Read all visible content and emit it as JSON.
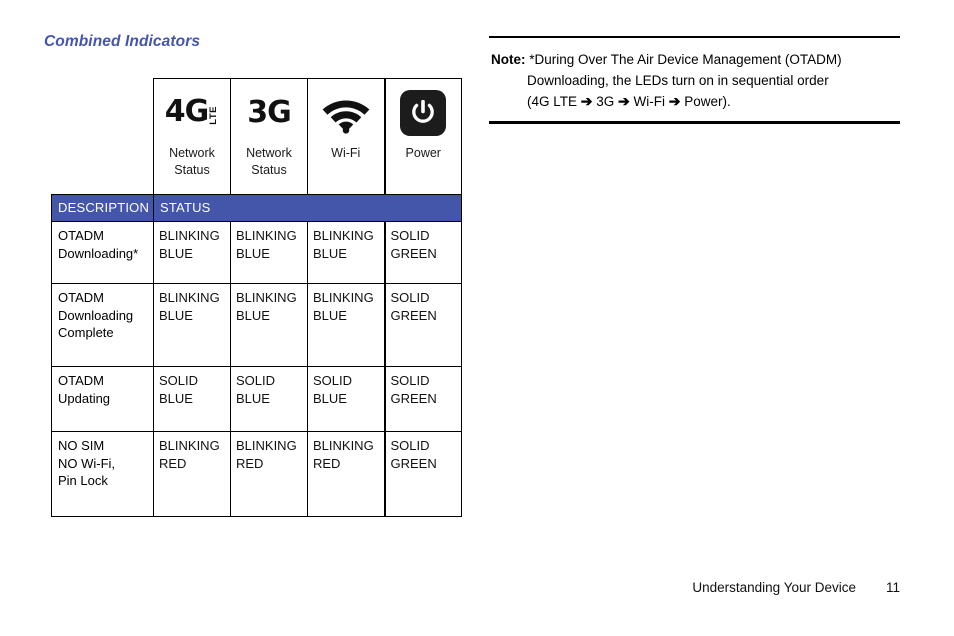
{
  "section": {
    "title": "Combined Indicators",
    "title_color": "#4455b0"
  },
  "table": {
    "accent_color": "#4456a9",
    "icon_header": [
      {
        "icon": "4g-lte-icon",
        "glyph_main": "4G",
        "glyph_sub": "LTE",
        "caption_line1": "Network",
        "caption_line2": "Status"
      },
      {
        "icon": "3g-icon",
        "glyph_main": "3G",
        "glyph_sub": "",
        "caption_line1": "Network",
        "caption_line2": "Status"
      },
      {
        "icon": "wifi-icon",
        "glyph_main": "",
        "glyph_sub": "",
        "caption_line1": "Wi-Fi",
        "caption_line2": ""
      },
      {
        "icon": "power-icon",
        "glyph_main": "",
        "glyph_sub": "",
        "caption_line1": "Power",
        "caption_line2": ""
      }
    ],
    "band": {
      "description_label": "DESCRIPTION",
      "status_label": "STATUS"
    },
    "rows": [
      {
        "description_lines": [
          "OTADM",
          "Downloading*"
        ],
        "statuses": [
          [
            "BLINKING",
            "BLUE"
          ],
          [
            "BLINKING",
            "BLUE"
          ],
          [
            "BLINKING",
            "BLUE"
          ],
          [
            "SOLID",
            "GREEN"
          ]
        ]
      },
      {
        "description_lines": [
          "OTADM",
          "Downloading",
          "Complete"
        ],
        "statuses": [
          [
            "BLINKING",
            "BLUE"
          ],
          [
            "BLINKING",
            "BLUE"
          ],
          [
            "BLINKING",
            "BLUE"
          ],
          [
            "SOLID",
            "GREEN"
          ]
        ]
      },
      {
        "description_lines": [
          "OTADM",
          "Updating"
        ],
        "statuses": [
          [
            "SOLID",
            "BLUE"
          ],
          [
            "SOLID",
            "BLUE"
          ],
          [
            "SOLID",
            "BLUE"
          ],
          [
            "SOLID",
            "GREEN"
          ]
        ]
      },
      {
        "description_lines": [
          "NO SIM",
          "NO Wi-Fi,",
          "Pin Lock"
        ],
        "statuses": [
          [
            "BLINKING",
            "RED"
          ],
          [
            "BLINKING",
            "RED"
          ],
          [
            "BLINKING",
            "RED"
          ],
          [
            "SOLID",
            "GREEN"
          ]
        ]
      }
    ]
  },
  "note": {
    "label": "Note:",
    "line1": "*During Over The Air Device Management (OTADM)",
    "line2": "Downloading, the LEDs turn on in sequential order",
    "line3_prefix": "(4G LTE ",
    "arrow": "➔",
    "line3_a": " 3G ",
    "line3_b": " Wi-Fi ",
    "line3_suffix": " Power)."
  },
  "footer": {
    "chapter": "Understanding Your Device",
    "page": "11"
  }
}
